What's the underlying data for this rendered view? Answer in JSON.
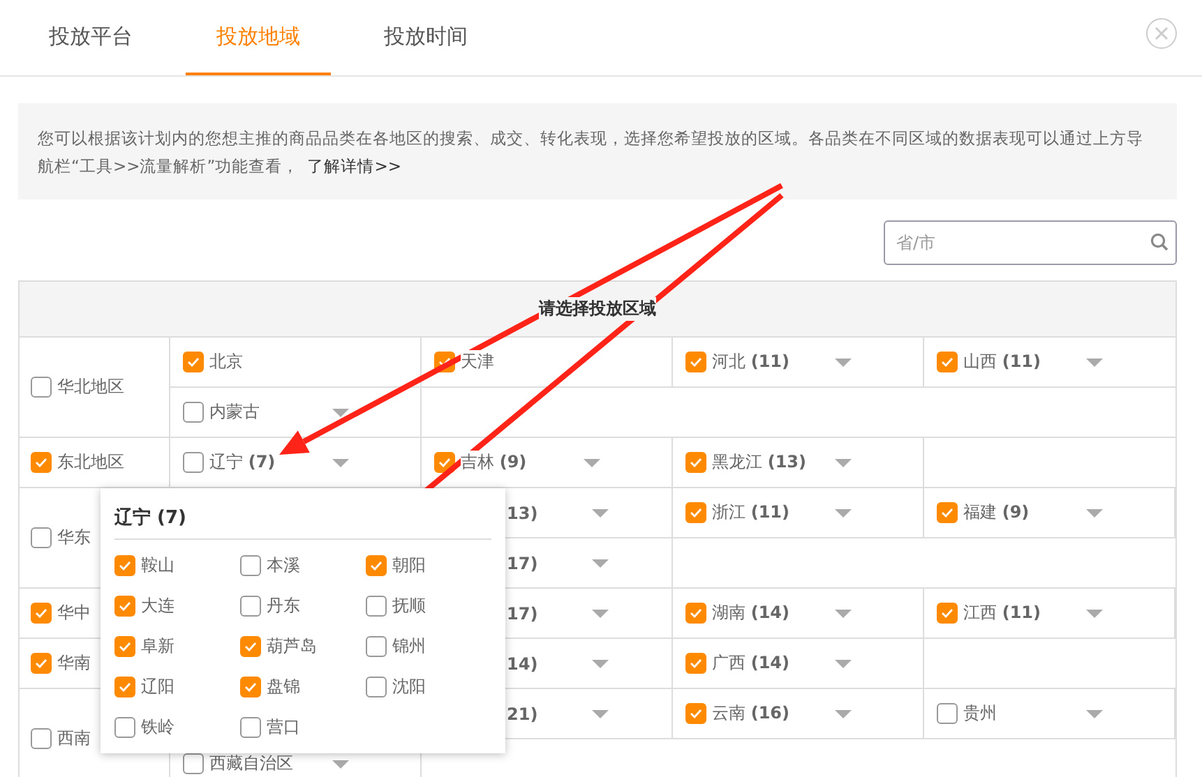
{
  "tabs": [
    {
      "label": "投放平台",
      "selected": false
    },
    {
      "label": "投放地域",
      "selected": true
    },
    {
      "label": "投放时间",
      "selected": false
    }
  ],
  "notice": {
    "text": "您可以根据该计划内的您想主推的商品品类在各地区的搜索、成交、转化表现，选择您希望投放的区域。各品类在不同区域的数据表现可以通过上方导航栏“工具>>流量解析”功能查看，",
    "link": "了解详情>>"
  },
  "search": {
    "placeholder": "省/市"
  },
  "table": {
    "title": "请选择投放区域",
    "regions": [
      {
        "name": "华北地区",
        "checked": false,
        "rows": [
          [
            {
              "kind": "plain",
              "label": "北京",
              "checked": true
            },
            {
              "kind": "plain",
              "label": "天津",
              "checked": true
            },
            {
              "kind": "dropdown",
              "label": "河北 **(11)**",
              "checked": true
            },
            {
              "kind": "dropdown",
              "label": "山西 **(11)**",
              "checked": true
            }
          ],
          [
            {
              "kind": "dropdown",
              "label": "内蒙古",
              "checked": false
            }
          ]
        ]
      },
      {
        "name": "东北地区",
        "checked": true,
        "rows": [
          [
            {
              "kind": "dropdown",
              "label": "辽宁 **(7)**",
              "checked": false
            },
            {
              "kind": "dropdown",
              "label": "吉林 **(9)**",
              "checked": true
            },
            {
              "kind": "dropdown",
              "label": "黑龙江 **(13)**",
              "checked": true
            }
          ]
        ]
      },
      {
        "name": "华东",
        "checked": false,
        "rows": [
          [
            {
              "kind": "partial",
              "label": "**13)**"
            },
            {
              "kind": "dropdown",
              "label": "浙江 **(11)**",
              "checked": true
            },
            {
              "kind": "dropdown",
              "label": "福建 **(9)**",
              "checked": true
            }
          ],
          [
            {
              "kind": "partial",
              "label": "**17)**"
            }
          ]
        ]
      },
      {
        "name": "华中",
        "checked": true,
        "rows": [
          [
            {
              "kind": "partial",
              "label": "**17)**"
            },
            {
              "kind": "dropdown",
              "label": "湖南 **(14)**",
              "checked": true
            },
            {
              "kind": "dropdown",
              "label": "江西 **(11)**",
              "checked": true
            }
          ]
        ]
      },
      {
        "name": "华南",
        "checked": true,
        "rows": [
          [
            {
              "kind": "partial",
              "label": "**14)**"
            },
            {
              "kind": "dropdown",
              "label": "广西 **(14)**",
              "checked": true
            }
          ]
        ]
      },
      {
        "name": "西南",
        "checked": false,
        "rows": [
          [
            {
              "kind": "partial",
              "label": "**21)**"
            },
            {
              "kind": "dropdown",
              "label": "云南 **(16)**",
              "checked": true
            },
            {
              "kind": "dropdown",
              "label": "贵州",
              "checked": false
            }
          ],
          [
            {
              "kind": "dropdown",
              "label": "西藏自治区",
              "checked": false
            }
          ]
        ]
      }
    ]
  },
  "popup": {
    "title": "辽宁 (7)",
    "items": [
      {
        "label": "鞍山",
        "checked": true
      },
      {
        "label": "本溪",
        "checked": false
      },
      {
        "label": "朝阳",
        "checked": true
      },
      {
        "label": "大连",
        "checked": true
      },
      {
        "label": "丹东",
        "checked": false
      },
      {
        "label": "抚顺",
        "checked": false
      },
      {
        "label": "阜新",
        "checked": true
      },
      {
        "label": "葫芦岛",
        "checked": true
      },
      {
        "label": "锦州",
        "checked": false
      },
      {
        "label": "辽阳",
        "checked": true
      },
      {
        "label": "盘锦",
        "checked": true
      },
      {
        "label": "沈阳",
        "checked": false
      },
      {
        "label": "铁岭",
        "checked": false
      },
      {
        "label": "营口",
        "checked": false
      }
    ]
  }
}
